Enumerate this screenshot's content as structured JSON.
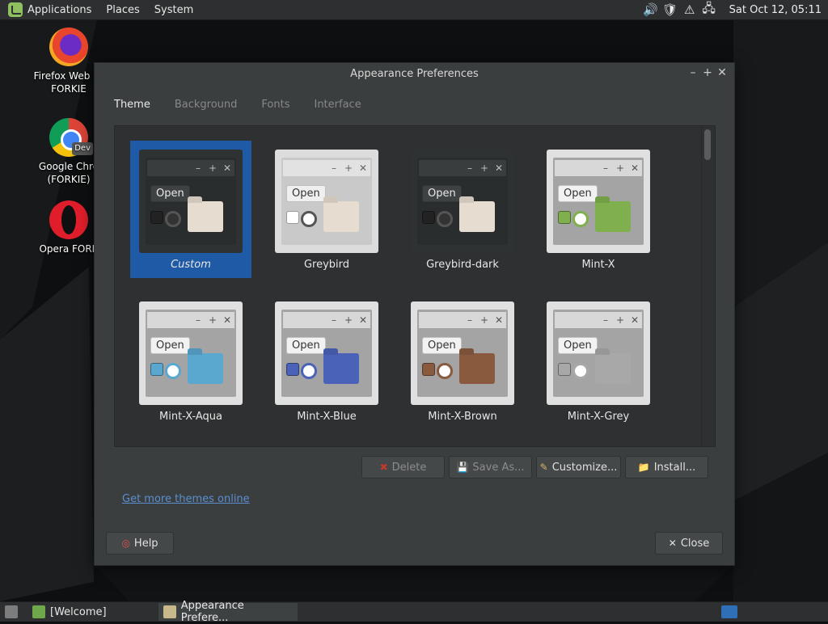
{
  "top_panel": {
    "menus": [
      "Applications",
      "Places",
      "System"
    ],
    "clock": "Sat Oct 12, 05:11",
    "tray_icons": [
      "speaker-icon",
      "shield-update-icon",
      "alert-icon",
      "network-icon"
    ]
  },
  "desktop": {
    "icons": [
      {
        "label": "Firefox Web Br\nFORKIE",
        "icon": "firefox-icon"
      },
      {
        "label": "Google Chro\n(FORKIE)",
        "icon": "chrome-dev-icon",
        "badge": "Dev"
      },
      {
        "label": "Opera FORK",
        "icon": "opera-icon"
      }
    ]
  },
  "window": {
    "title": "Appearance Preferences",
    "tabs": [
      {
        "label": "Theme",
        "active": true
      },
      {
        "label": "Background",
        "active": false
      },
      {
        "label": "Fonts",
        "active": false
      },
      {
        "label": "Interface",
        "active": false
      }
    ],
    "themes": [
      {
        "name": "Custom",
        "selected": true,
        "open_label": "Open",
        "style": "dark"
      },
      {
        "name": "Greybird",
        "selected": false,
        "open_label": "Open",
        "style": "light"
      },
      {
        "name": "Greybird-dark",
        "selected": false,
        "open_label": "Open",
        "style": "dark"
      },
      {
        "name": "Mint-X",
        "selected": false,
        "open_label": "Open",
        "style": "mint",
        "accent": "#7fb04d"
      },
      {
        "name": "Mint-X-Aqua",
        "selected": false,
        "open_label": "Open",
        "style": "mint",
        "accent": "#5aa7cf"
      },
      {
        "name": "Mint-X-Blue",
        "selected": false,
        "open_label": "Open",
        "style": "mint",
        "accent": "#4a63b8"
      },
      {
        "name": "Mint-X-Brown",
        "selected": false,
        "open_label": "Open",
        "style": "mint",
        "accent": "#8a5a3f"
      },
      {
        "name": "Mint-X-Grey",
        "selected": false,
        "open_label": "Open",
        "style": "mint",
        "accent": "#a8a8a8"
      }
    ],
    "buttons": {
      "delete": "Delete",
      "save_as": "Save As...",
      "customize": "Customize...",
      "install": "Install...",
      "help": "Help",
      "close": "Close"
    },
    "more_themes_link": "Get more themes online"
  },
  "taskbar": {
    "items": [
      {
        "label": "[Welcome]",
        "active": false
      },
      {
        "label": "Appearance Prefere...",
        "active": true
      }
    ]
  },
  "colors": {
    "selection": "#1f5aa6",
    "link": "#5a8fd0"
  }
}
